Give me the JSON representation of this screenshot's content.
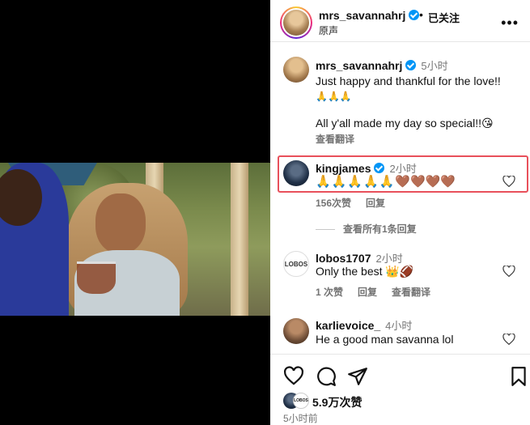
{
  "post": {
    "username": "mrs_savannahrj",
    "follow_status": "已关注",
    "audio": "原声",
    "more": "•••"
  },
  "caption": {
    "username": "mrs_savannahrj",
    "time": "5小时",
    "line1": "Just happy and thankful for the love!!",
    "emojis": "🙏🙏🙏",
    "line2": "All y'all made my day so special!!😘",
    "translate": "查看翻译"
  },
  "comments": [
    {
      "username": "kingjames",
      "time": "2小时",
      "hands": "🙏🙏🙏🙏🙏",
      "hearts": "🤎🤎🤎🤎",
      "likes": "156次赞",
      "reply": "回复",
      "view_replies": "查看所有1条回复"
    },
    {
      "username": "lobos1707",
      "time": "2小时",
      "text": "Only the best 👑🏈",
      "likes": "1 次赞",
      "reply": "回复",
      "translate": "查看翻译"
    },
    {
      "username": "karlievoice_",
      "time": "4小时",
      "text": "He a good man savanna lol"
    }
  ],
  "actions": {
    "total_likes": "5.9万次赞",
    "posted": "5小时前"
  },
  "colors": {
    "highlight": "#e8505b",
    "verified": "#0095f6",
    "muted": "#737373"
  }
}
